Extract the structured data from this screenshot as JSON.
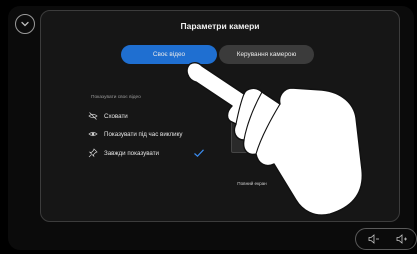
{
  "header": {
    "title": "Параметри камери"
  },
  "tabs": [
    {
      "label": "Своє відео",
      "active": true
    },
    {
      "label": "Керування камерою",
      "active": false
    }
  ],
  "self_view": {
    "section_label": "Показувати своє відео",
    "options": [
      {
        "label": "Сховати",
        "icon": "eye-off-icon",
        "selected": false
      },
      {
        "label": "Показувати під час виклику",
        "icon": "eye-icon",
        "selected": false
      },
      {
        "label": "Завжди показувати",
        "icon": "pin-icon",
        "selected": true
      }
    ]
  },
  "preview": {
    "label": "Повний екран"
  },
  "colors": {
    "accent": "#1f6fd1",
    "panel": "#161616",
    "background": "#000000"
  }
}
